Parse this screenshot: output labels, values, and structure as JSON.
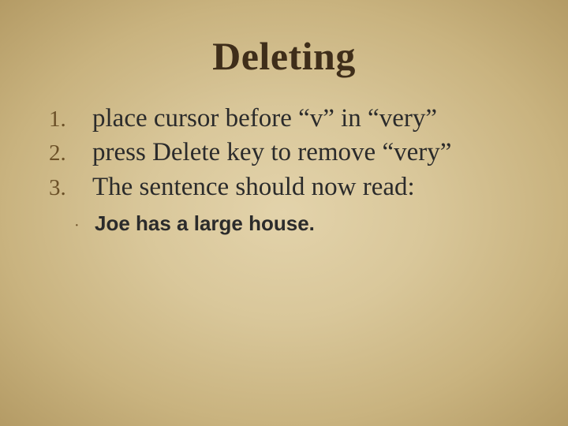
{
  "title": "Deleting",
  "steps": {
    "n1": "1.",
    "n2": "2.",
    "n3": "3.",
    "s1": "place cursor before “v” in “very”",
    "s2": "press Delete key to remove “very”",
    "s3": "The sentence should now read:"
  },
  "bullet": {
    "mark": "·",
    "text": "Joe has a large house."
  }
}
